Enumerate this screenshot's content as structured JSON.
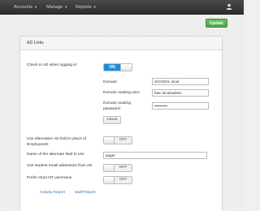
{
  "navbar": {
    "items": [
      {
        "label": "Accounts"
      },
      {
        "label": "Manage"
      },
      {
        "label": "Reports"
      }
    ]
  },
  "toolbar": {
    "update_label": "Update"
  },
  "panel": {
    "title": "AD Links",
    "check_in_ad": {
      "label": "Check in AD when logging in:",
      "state": "ON"
    },
    "domain": {
      "label": "Domain:",
      "value": "SCHOOL.local"
    },
    "reading_user": {
      "label": "Domain reading user:",
      "value": "fasc.localsadmin"
    },
    "reading_password": {
      "label_line1": "Domain reading",
      "label_line2": "password:",
      "value": "••••••••••"
    },
    "check_button": "Check",
    "alt_ad_field": {
      "label_line1": "Use alternative AD field in place of",
      "label_line2": "EmployeeID:",
      "state": "OFF"
    },
    "alt_field_name": {
      "label": "Name of the alternate field to use",
      "value": "pager"
    },
    "student_email": {
      "label": "Use student email addresses from AD",
      "state": "OFF"
    },
    "short_nt": {
      "label": "Prefer short NT username",
      "state": "OFF"
    },
    "links": {
      "activity": "Activity Report",
      "staff": "Staff Report"
    }
  },
  "colors": {
    "toggle_on": "#1f8dd6",
    "update_green": "#51a351",
    "navbar": "#333333"
  }
}
